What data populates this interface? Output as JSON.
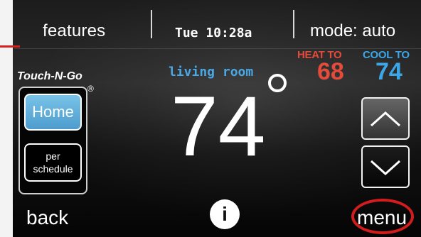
{
  "header": {
    "features_label": "features",
    "datetime": "Tue 10:28a",
    "mode_label": "mode: auto"
  },
  "setpoints": {
    "heat_label": "HEAT TO",
    "heat_value": "68",
    "cool_label": "COOL TO",
    "cool_value": "74"
  },
  "branding": {
    "name": "Touch-N-Go",
    "registered": "®"
  },
  "main": {
    "room_label": "living room",
    "temperature": "74"
  },
  "side_buttons": {
    "home": "Home",
    "schedule_line1": "per",
    "schedule_line2": "schedule"
  },
  "footer": {
    "back": "back",
    "info": "i",
    "menu": "menu"
  },
  "colors": {
    "heat": "#e44b3b",
    "cool": "#3ba7e6",
    "highlight": "#d31d1d",
    "home_button": "#4d9ccd"
  },
  "icons": {
    "degree": "degree-icon",
    "up": "chevron-up-icon",
    "down": "chevron-down-icon",
    "info": "info-icon"
  }
}
